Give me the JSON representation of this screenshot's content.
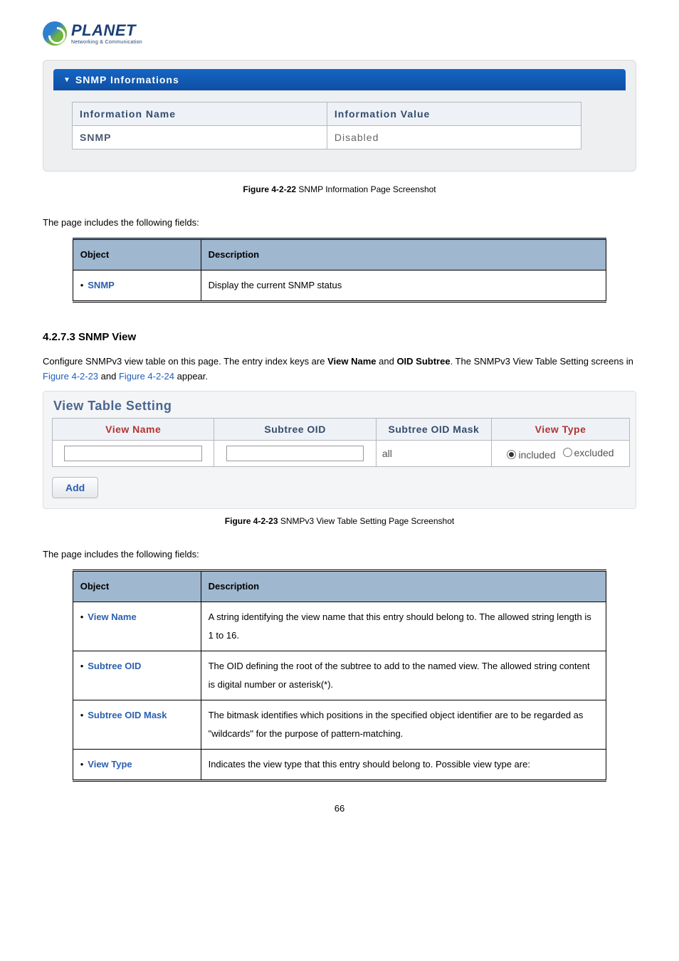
{
  "logo": {
    "brand": "PLANET",
    "tagline": "Networking & Communication"
  },
  "snmp_info_panel": {
    "header": "SNMP Informations",
    "columns": {
      "name": "Information Name",
      "value": "Information Value"
    },
    "row": {
      "name": "SNMP",
      "value": "Disabled"
    }
  },
  "caption1": {
    "label": "Figure 4-2-22",
    "text": " SNMP Information Page Screenshot"
  },
  "intro1": "The page includes the following fields:",
  "objtable1": {
    "headers": {
      "object": "Object",
      "description": "Description"
    },
    "rows": [
      {
        "object": "SNMP",
        "description": "Display the current SNMP status"
      }
    ]
  },
  "section": {
    "heading": "4.2.7.3 SNMP View",
    "para_pre": "Configure SNMPv3 view table on this page. The entry index keys are ",
    "bold1": "View Name",
    "mid": " and ",
    "bold2": "OID Subtree",
    "post1": ". The SNMPv3 View Table Setting screens in ",
    "link1": "Figure 4-2-23",
    "post2": " and ",
    "link2": "Figure 4-2-24",
    "post3": " appear."
  },
  "vts": {
    "title": "View Table Setting",
    "headers": {
      "view_name": "View Name",
      "subtree_oid": "Subtree OID",
      "subtree_oid_mask": "Subtree OID Mask",
      "view_type": "View Type"
    },
    "row": {
      "view_name": "",
      "subtree_oid": "",
      "subtree_oid_mask": "all",
      "view_type_included": "included",
      "view_type_excluded": "excluded"
    },
    "add_label": "Add"
  },
  "caption2": {
    "label": "Figure 4-2-23",
    "text": " SNMPv3 View Table Setting Page Screenshot"
  },
  "intro2": "The page includes the following fields:",
  "objtable2": {
    "headers": {
      "object": "Object",
      "description": "Description"
    },
    "rows": [
      {
        "object": "View Name",
        "description": "A string identifying the view name that this entry should belong to.\nThe allowed string length is 1 to 16."
      },
      {
        "object": "Subtree OID",
        "description": "The OID defining the root of the subtree to add to the named view.\nThe allowed string content is digital number or asterisk(*)."
      },
      {
        "object": "Subtree OID Mask",
        "description": "The bitmask identifies which positions in the specified object identifier are to be regarded as \"wildcards\" for the purpose of pattern-matching."
      },
      {
        "object": "View Type",
        "description": "Indicates the view type that this entry should belong to. Possible view type are:"
      }
    ]
  },
  "page_number": "66"
}
